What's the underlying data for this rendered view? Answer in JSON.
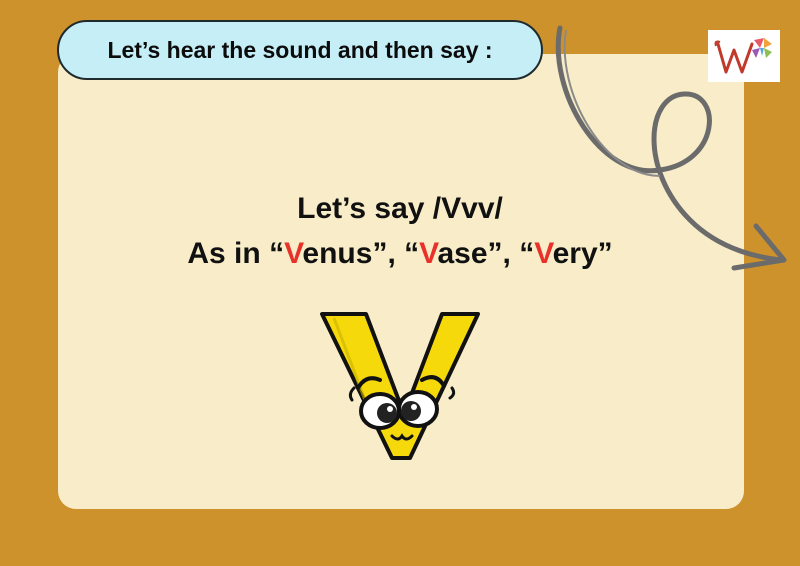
{
  "header": {
    "instruction": "Let’s hear the sound and then say :"
  },
  "lesson": {
    "line1": "Let’s say /Vvv/",
    "line2": {
      "prefix": "As in ",
      "words": [
        {
          "open": "“",
          "initial": "V",
          "rest": "enus",
          "close": "”",
          "sep": ", "
        },
        {
          "open": "“",
          "initial": "V",
          "rest": "ase",
          "close": "”",
          "sep": ", "
        },
        {
          "open": "“",
          "initial": "V",
          "rest": "ery",
          "close": "”",
          "sep": ""
        }
      ]
    }
  },
  "colors": {
    "background": "#cd922b",
    "card": "#f8edc8",
    "pill": "#c6eef7",
    "highlight": "#e8312a",
    "mascot": "#f5d90a"
  },
  "icons": {
    "logo": "w-logo-icon",
    "arrow": "curly-arrow-icon",
    "mascot": "letter-v-character"
  }
}
